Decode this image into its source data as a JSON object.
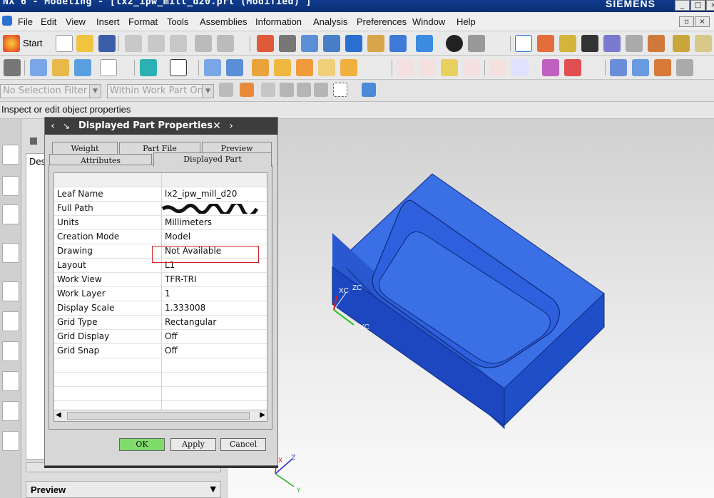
{
  "window": {
    "title": "NX 6 - Modeling - [lx2_ipw_mill_d20.prt (Modified) ]",
    "brand": "SIEMENS"
  },
  "menu": [
    "File",
    "Edit",
    "View",
    "Insert",
    "Format",
    "Tools",
    "Assemblies",
    "Information",
    "Analysis",
    "Preferences",
    "Window",
    "Help"
  ],
  "toolbar": {
    "start_label": "Start"
  },
  "selection": {
    "filter": "No Selection Filter",
    "scope": "Within Work Part Only"
  },
  "cue_line": "Inspect or edit object properties",
  "nav_panel": {
    "column_label": "Des",
    "preview_label": "Preview"
  },
  "dialog": {
    "title": "Displayed Part Properties",
    "tabs_back": [
      "Weight",
      "Part File",
      "Preview"
    ],
    "tabs_front": [
      "Attributes",
      "Displayed Part"
    ],
    "active_tab": "Displayed Part",
    "properties": [
      {
        "key": "Leaf Name",
        "value": "lx2_ipw_mill_d20"
      },
      {
        "key": "Full Path",
        "value": ""
      },
      {
        "key": "Units",
        "value": "Millimeters"
      },
      {
        "key": "Creation Mode",
        "value": "Model"
      },
      {
        "key": "Drawing",
        "value": "Not Available"
      },
      {
        "key": "Layout",
        "value": "L1"
      },
      {
        "key": "Work View",
        "value": "TFR-TRI"
      },
      {
        "key": "Work Layer",
        "value": "1"
      },
      {
        "key": "Display Scale",
        "value": "1.333008"
      },
      {
        "key": "Grid Type",
        "value": "Rectangular"
      },
      {
        "key": "Grid Display",
        "value": "Off"
      },
      {
        "key": "Grid Snap",
        "value": "Off"
      }
    ],
    "buttons": {
      "ok": "OK",
      "apply": "Apply",
      "cancel": "Cancel"
    }
  },
  "viewport": {
    "axes_labels": {
      "xc": "XC",
      "zc": "ZC",
      "yc": "YC",
      "x": "X",
      "y": "Y",
      "z": "Z"
    },
    "part_color": "#2f63e8"
  },
  "colors": {
    "highlight_box": "#d82020",
    "ok_button": "#7fdc6a"
  }
}
